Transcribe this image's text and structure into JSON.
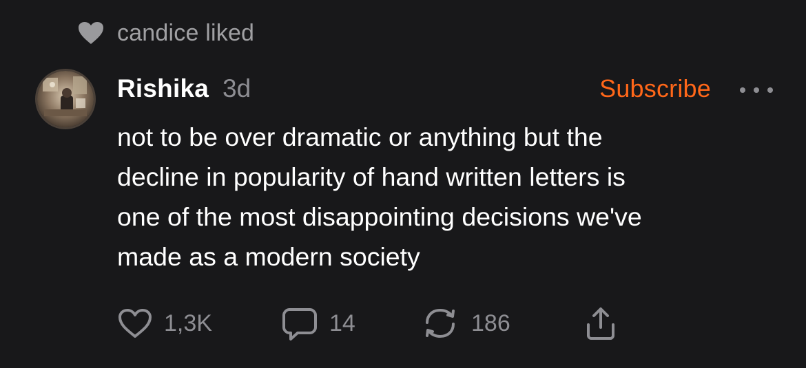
{
  "activity": {
    "liked_by_text": "candice liked",
    "icon": "heart-icon"
  },
  "post": {
    "author": "Rishika",
    "time": "3d",
    "subscribe_label": "Subscribe",
    "more_icon": "more-icon",
    "body_lines": [
      "not to be over dramatic or anything but the",
      "decline in popularity of hand written letters is",
      "one of the most disappointing decisions we've",
      "made as a modern society"
    ]
  },
  "actions": {
    "like_count": "1,3K",
    "comment_count": "14",
    "restack_count": "186",
    "icons": [
      "heart-outline-icon",
      "comment-icon",
      "restack-icon",
      "share-icon"
    ]
  },
  "colors": {
    "background": "#18181a",
    "accent": "#ff6719",
    "muted": "#8e8e93",
    "text": "#ffffff"
  }
}
